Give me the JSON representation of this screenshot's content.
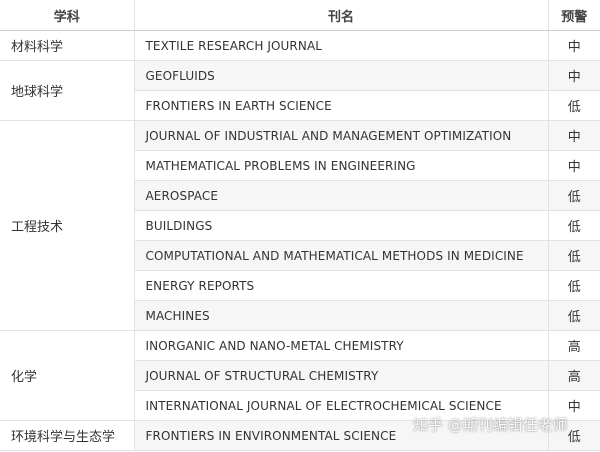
{
  "table": {
    "headers": {
      "subject": "学科",
      "journal": "刊名",
      "warning": "预警"
    },
    "groups": [
      {
        "subject": "材料科学",
        "rows": [
          {
            "journal": "TEXTILE RESEARCH JOURNAL",
            "warning": "中"
          }
        ]
      },
      {
        "subject": "地球科学",
        "rows": [
          {
            "journal": "GEOFLUIDS",
            "warning": "中"
          },
          {
            "journal": "FRONTIERS IN EARTH SCIENCE",
            "warning": "低"
          }
        ]
      },
      {
        "subject": "工程技术",
        "rows": [
          {
            "journal": "JOURNAL OF INDUSTRIAL AND MANAGEMENT OPTIMIZATION",
            "warning": "中"
          },
          {
            "journal": "MATHEMATICAL PROBLEMS IN ENGINEERING",
            "warning": "中"
          },
          {
            "journal": "AEROSPACE",
            "warning": "低"
          },
          {
            "journal": "BUILDINGS",
            "warning": "低"
          },
          {
            "journal": "COMPUTATIONAL AND MATHEMATICAL METHODS IN MEDICINE",
            "warning": "低"
          },
          {
            "journal": "ENERGY REPORTS",
            "warning": "低"
          },
          {
            "journal": "MACHINES",
            "warning": "低"
          }
        ]
      },
      {
        "subject": "化学",
        "rows": [
          {
            "journal": "INORGANIC AND NANO-METAL CHEMISTRY",
            "warning": "高"
          },
          {
            "journal": "JOURNAL OF STRUCTURAL CHEMISTRY",
            "warning": "高"
          },
          {
            "journal": "INTERNATIONAL JOURNAL OF ELECTROCHEMICAL SCIENCE",
            "warning": "中"
          }
        ]
      },
      {
        "subject": "环境科学与生态学",
        "rows": [
          {
            "journal": "FRONTIERS IN ENVIRONMENTAL SCIENCE",
            "warning": "低"
          }
        ]
      }
    ]
  },
  "watermark": "知乎 @期刊编辑任老师"
}
